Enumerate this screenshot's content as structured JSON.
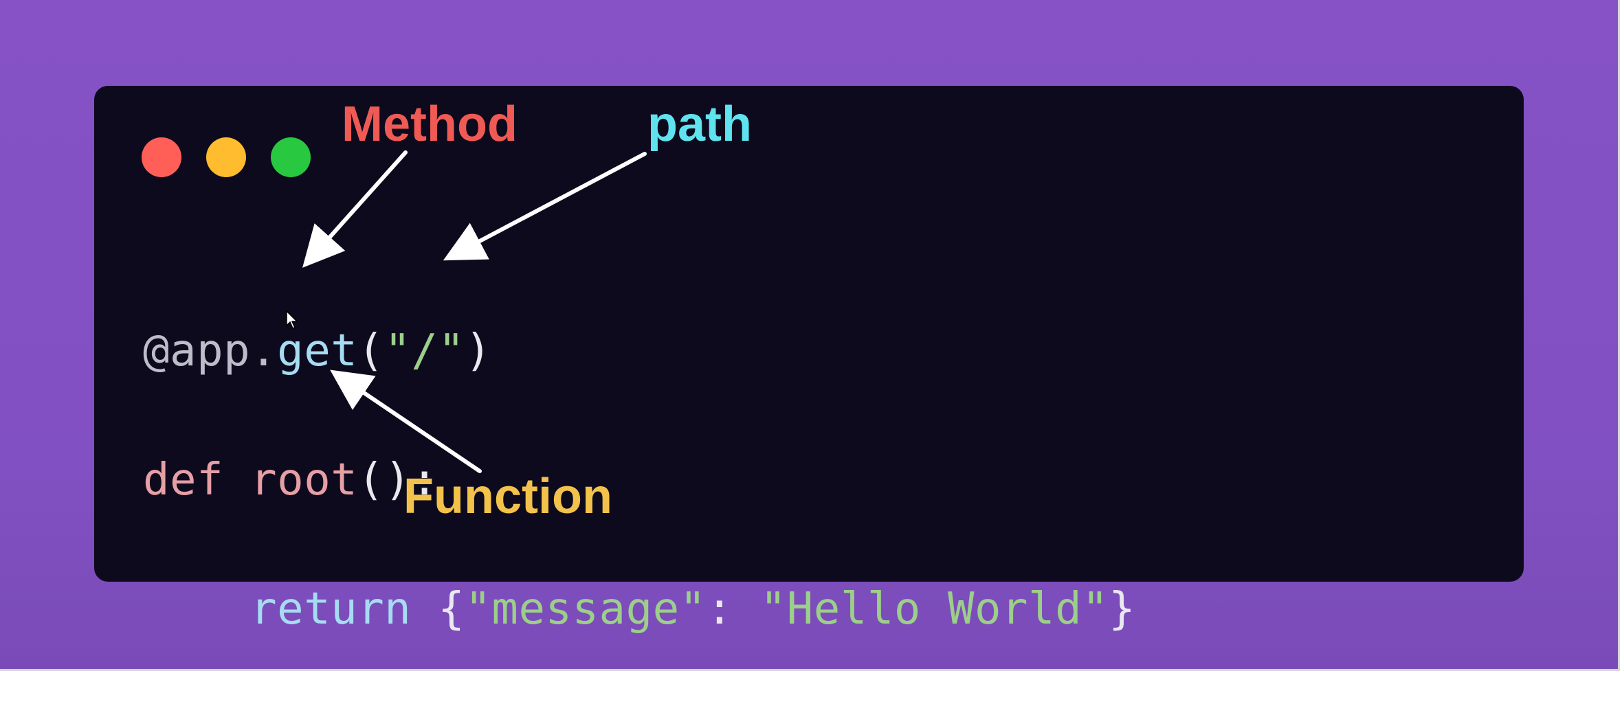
{
  "annotations": {
    "method_label": "Method",
    "path_label": "path",
    "function_label": "Function"
  },
  "code": {
    "line1": {
      "decorator": "@app.",
      "method": "get",
      "open": "(",
      "path": "\"/\"",
      "close": ")"
    },
    "line2": {
      "keyword": "def",
      "function_name": "root",
      "parens": "():"
    },
    "line3": {
      "indent": "    ",
      "keyword": "return",
      "open_brace": "{",
      "key": "\"message\"",
      "colon": ": ",
      "value": "\"Hello World\"",
      "close_brace": "}"
    }
  },
  "colors": {
    "background": "#8652c6",
    "code_panel": "#0e0a1e",
    "method_label": "#f05a55",
    "path_label": "#5fe3ef",
    "function_label": "#f2c24a",
    "traffic_red": "#ff5f57",
    "traffic_yellow": "#febc2e",
    "traffic_green": "#28c840"
  }
}
